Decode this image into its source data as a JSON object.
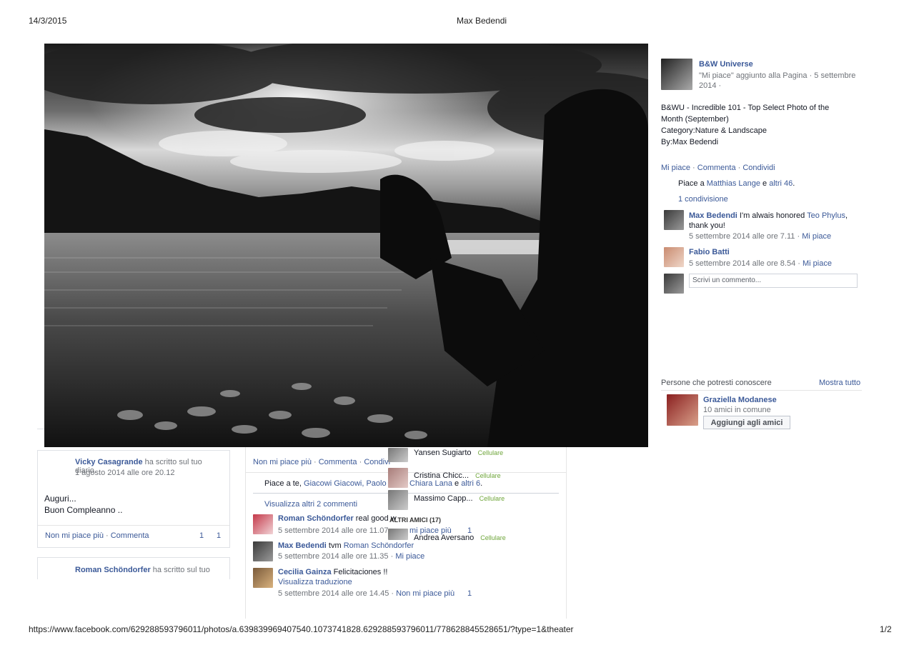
{
  "header": {
    "date": "14/3/2015",
    "title": "Max Bedendi"
  },
  "footer": {
    "url": "https://www.facebook.com/629288593796011/photos/a.639839969407540.1073741828.629288593796011/778628845528651/?type=1&theater",
    "page": "1/2"
  },
  "post": {
    "page_name": "B&W Universe",
    "liked_note": "\"Mi piace\" aggiunto alla Pagina · 5 settembre 2014 ·",
    "text": [
      "B&WU - Incredible 101 - Top Select Photo of the",
      "Month (September)",
      "Category:Nature & Landscape",
      "By:Max Bedendi"
    ],
    "actions": {
      "like": "Mi piace",
      "comment": "Commenta",
      "share": "Condividi",
      "sep": "·"
    },
    "likes": {
      "prefix": "Piace a",
      "person": "Matthias Lange",
      "and": "e",
      "others": "altri 46",
      "end": "."
    },
    "shares": "1 condivisione",
    "comments": [
      {
        "author": "Max Bedendi",
        "text_a": "I'm alwais honored",
        "mention": "Teo Phylus",
        "text_b": "thank you!",
        "time": "5 settembre 2014 alle ore 7.11",
        "like": "Mi piace"
      },
      {
        "author": "Fabio Batti",
        "time": "5 settembre 2014 alle ore 8.54",
        "like": "Mi piace"
      }
    ],
    "comment_placeholder": "Scrivi un commento..."
  },
  "people": {
    "heading": "Persone che potresti conoscere",
    "see_all": "Mostra tutto",
    "person": {
      "name": "Graziella Modanese",
      "mutual": "10 amici in comune",
      "button": "Aggiungi agli amici"
    }
  },
  "feed_left": {
    "post1": {
      "author": "Vicky Casagrande",
      "action": "ha scritto sul tuo diario.",
      "time": "1 agosto 2014 alle ore 20.12",
      "line1": "Auguri...",
      "line2": "Buon Compleanno ..",
      "unlike": "Non mi piace più",
      "comment": "Commenta",
      "count1": "1",
      "count2": "1"
    },
    "post2": {
      "author": "Roman Schöndorfer",
      "action": "ha scritto sul tuo"
    }
  },
  "feed_center": {
    "actions": {
      "unlike": "Non mi piace più",
      "comment": "Commenta",
      "share": "Condivi"
    },
    "likes": {
      "prefix": "Piace a te,",
      "p1": "Giacowi Giacowi,",
      "p2": "Paolo T",
      "p3": "Chiara Lana",
      "and": "e",
      "others": "altri 6",
      "end": "."
    },
    "more_comments": "Visualizza altri 2 commenti",
    "comments": [
      {
        "author": "Roman Schöndorfer",
        "text": "real good w",
        "time": "5 settembre 2014 alle ore 11.07",
        "action": "mi piace più",
        "count": "1"
      },
      {
        "author": "Max Bedendi",
        "text": "tvm",
        "mention": "Roman Schöndorfer",
        "time": "5 settembre 2014 alle ore 11.35",
        "action": "Mi piace"
      },
      {
        "author": "Cecilia Gainza",
        "text": "Felicitaciones !!",
        "translate": "Visualizza traduzione",
        "time": "5 settembre 2014 alle ore 14.45",
        "action": "Non mi piace più",
        "count": "1"
      }
    ]
  },
  "chat": {
    "friends": [
      {
        "name": "Yansen Sugiarto",
        "status": "Cellulare"
      },
      {
        "name": "Cristina Chicc...",
        "status": "Cellulare"
      },
      {
        "name": "Massimo Capp...",
        "status": "Cellulare"
      }
    ],
    "others_header": "ALTRI AMICI (17)",
    "others": [
      {
        "name": "Andrea Aversano",
        "status": "Cellulare"
      }
    ]
  },
  "icons": {
    "page_avatar": "bw-universe-logo",
    "photo": "black-and-white-lake-landscape"
  }
}
